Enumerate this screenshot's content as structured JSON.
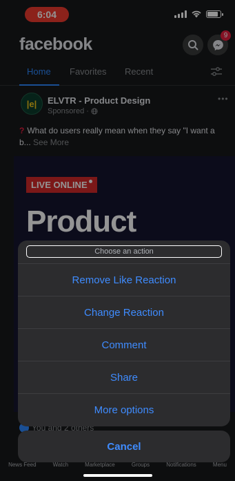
{
  "status_bar": {
    "time": "6:04",
    "battery_level": 0.85
  },
  "header": {
    "logo": "facebook",
    "messenger_badge": "9"
  },
  "tabs": [
    {
      "label": "Home",
      "active": true
    },
    {
      "label": "Favorites",
      "active": false
    },
    {
      "label": "Recent",
      "active": false
    }
  ],
  "post": {
    "page_name": "ELVTR - Product Design",
    "avatar_text": "|e|",
    "sponsored": "Sponsored · ",
    "text_mark": "?",
    "text": "What do users really mean when they say \"I want a b...",
    "see_more": "See More",
    "ad_badge": "LIVE ONLINE",
    "ad_headline": "Product",
    "reactions_text": "You and 2 others"
  },
  "action_sheet": {
    "title": "Choose an action",
    "options": [
      "Remove Like Reaction",
      "Change Reaction",
      "Comment",
      "Share",
      "More options"
    ],
    "cancel": "Cancel"
  },
  "bottom_nav": [
    "News Feed",
    "Watch",
    "Marketplace",
    "Groups",
    "Notifications",
    "Menu"
  ],
  "colors": {
    "accent": "#3f8cff",
    "background": "#18191a",
    "sheet": "#2c2c2e",
    "time_pill": "#f23c30",
    "badge": "#e41e3f"
  }
}
